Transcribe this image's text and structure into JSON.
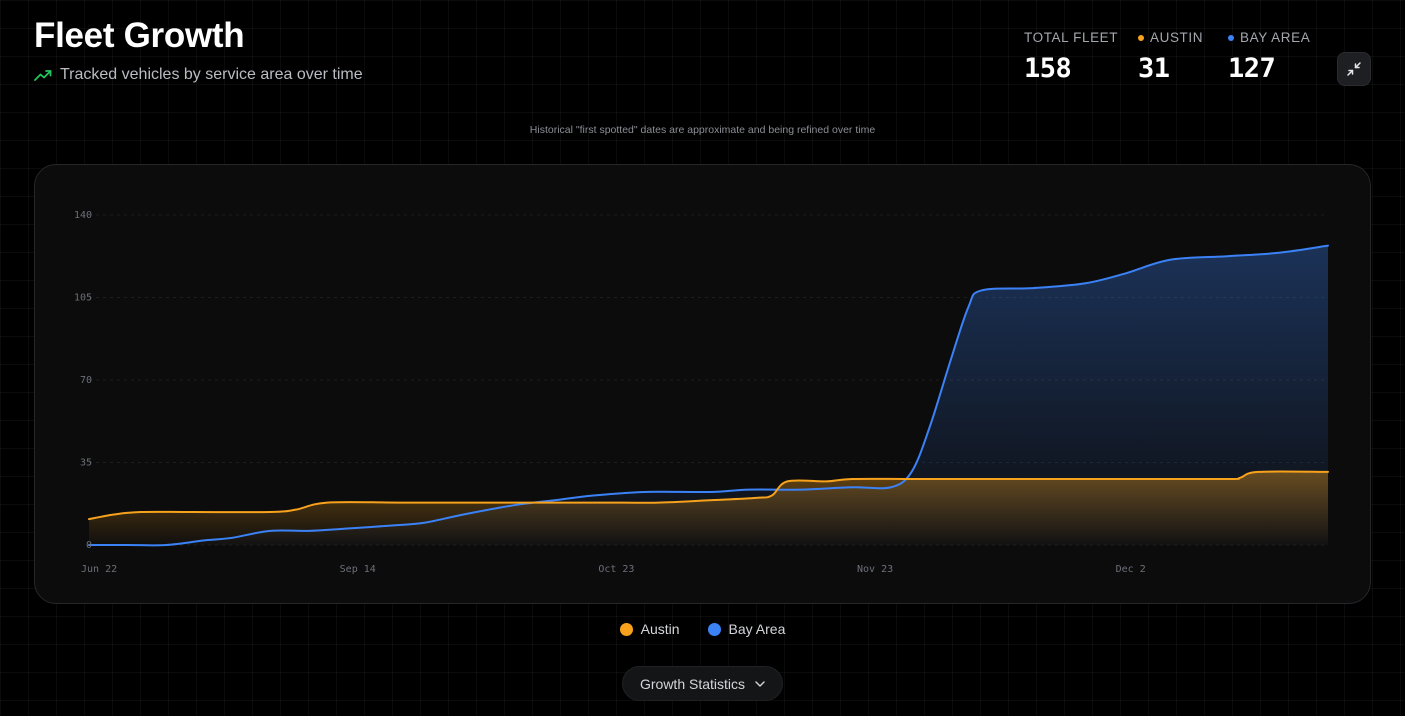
{
  "header": {
    "title": "Fleet Growth",
    "subtitle": "Tracked vehicles by service area over time",
    "subtitle_icon": "trending-up-icon"
  },
  "stats": {
    "total": {
      "label": "TOTAL FLEET",
      "value": "158"
    },
    "austin": {
      "label": "AUSTIN",
      "value": "31",
      "color": "#f7a21c"
    },
    "bay_area": {
      "label": "BAY AREA",
      "value": "127",
      "color": "#3b82f6"
    }
  },
  "collapse_button": {
    "icon": "collapse-icon"
  },
  "note": "Historical \"first spotted\" dates are approximate and being refined over time",
  "legend": [
    {
      "label": "Austin",
      "color": "#f7a21c"
    },
    {
      "label": "Bay Area",
      "color": "#3b82f6"
    }
  ],
  "growth_button": {
    "label": "Growth Statistics",
    "icon": "chevron-down-icon"
  },
  "chart_data": {
    "type": "area",
    "title": "",
    "xlabel": "",
    "ylabel": "",
    "ylim": [
      0,
      140
    ],
    "yticks": [
      0,
      35,
      70,
      105,
      140
    ],
    "xticks": [
      {
        "label": "Jun 22",
        "x": 0
      },
      {
        "label": "Sep 14",
        "x": 100
      },
      {
        "label": "Oct 23",
        "x": 200
      },
      {
        "label": "Nov 23",
        "x": 300
      },
      {
        "label": "Dec 2",
        "x": 400
      }
    ],
    "xlim": [
      0,
      479
    ],
    "grid": true,
    "series": [
      {
        "name": "Austin",
        "color": "#f7a21c",
        "points": [
          [
            0,
            11
          ],
          [
            10,
            13
          ],
          [
            20,
            14
          ],
          [
            40,
            14
          ],
          [
            70,
            14
          ],
          [
            80,
            15
          ],
          [
            92,
            18
          ],
          [
            120,
            18
          ],
          [
            150,
            18
          ],
          [
            180,
            18
          ],
          [
            200,
            18
          ],
          [
            220,
            18
          ],
          [
            240,
            19
          ],
          [
            258,
            20
          ],
          [
            264,
            21
          ],
          [
            270,
            27
          ],
          [
            285,
            27
          ],
          [
            295,
            28
          ],
          [
            320,
            28
          ],
          [
            360,
            28
          ],
          [
            400,
            28
          ],
          [
            440,
            28
          ],
          [
            445,
            28.5
          ],
          [
            452,
            31
          ],
          [
            479,
            31
          ]
        ]
      },
      {
        "name": "Bay Area",
        "color": "#3b82f6",
        "points": [
          [
            0,
            0
          ],
          [
            15,
            0
          ],
          [
            30,
            0
          ],
          [
            45,
            2
          ],
          [
            55,
            3
          ],
          [
            70,
            6
          ],
          [
            85,
            6
          ],
          [
            100,
            7
          ],
          [
            120,
            8.5
          ],
          [
            130,
            9.5
          ],
          [
            145,
            13
          ],
          [
            165,
            17
          ],
          [
            180,
            19
          ],
          [
            195,
            21
          ],
          [
            215,
            22.5
          ],
          [
            240,
            22.5
          ],
          [
            255,
            23.5
          ],
          [
            275,
            23.5
          ],
          [
            295,
            24.5
          ],
          [
            310,
            24.5
          ],
          [
            318,
            31
          ],
          [
            325,
            50
          ],
          [
            333,
            78
          ],
          [
            340,
            101
          ],
          [
            345,
            108
          ],
          [
            365,
            109
          ],
          [
            385,
            111
          ],
          [
            400,
            115
          ],
          [
            418,
            121
          ],
          [
            440,
            122.5
          ],
          [
            460,
            124
          ],
          [
            479,
            127
          ]
        ]
      }
    ]
  }
}
